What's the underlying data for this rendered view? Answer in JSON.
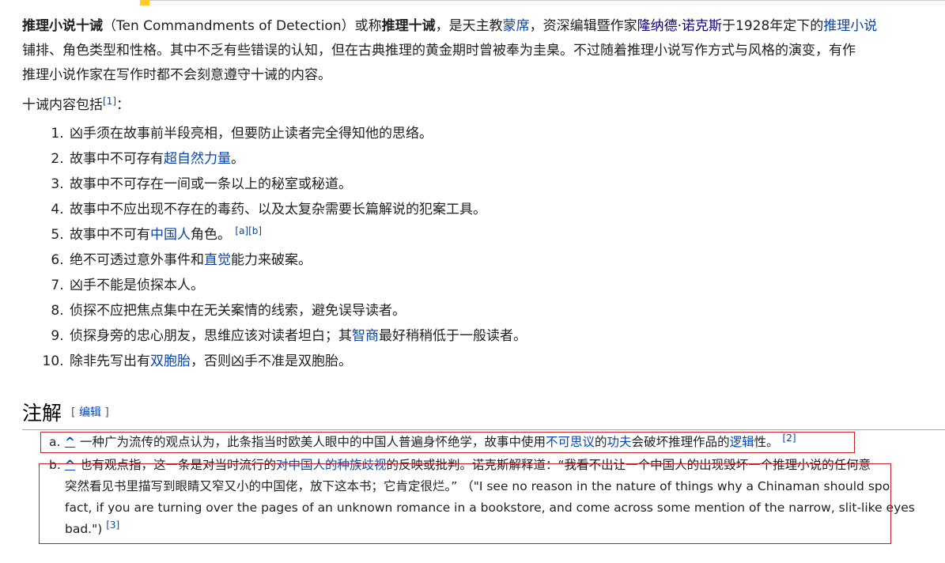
{
  "intro": {
    "line1": {
      "bold1": "推理小说十诫",
      "t1": "（Ten Commandments of Detection）或称",
      "bold2": "推理十诫",
      "t2": "，是天主教",
      "link_monsignor": "蒙席",
      "t3": "，资深编辑暨作家",
      "link_knox": "隆纳德·诺克斯",
      "t4": "于1928年定下的",
      "link_detective": "推理小说"
    },
    "line2": "铺排、角色类型和性格。其中不乏有些错误的认知，但在古典推理的黄金期时曾被奉为圭臬。不过随着推理小说写作方式与风格的演变，有作",
    "line3": "推理小说作家在写作时都不会刻意遵守十诫的内容。"
  },
  "list_intro": {
    "text": "十诫内容包括",
    "ref": "[1]",
    "colon": "："
  },
  "commandments": [
    {
      "pre": "凶手须在故事前半段亮相，但要防止读者完全得知他的思络。",
      "link": "",
      "post": "",
      "ref": ""
    },
    {
      "pre": "故事中不可存有",
      "link": "超自然力量",
      "post": "。",
      "ref": ""
    },
    {
      "pre": "故事中不可存在一间或一条以上的秘室或秘道。",
      "link": "",
      "post": "",
      "ref": ""
    },
    {
      "pre": "故事中不应出现不存在的毒药、以及太复杂需要长篇解说的犯案工具。",
      "link": "",
      "post": "",
      "ref": ""
    },
    {
      "pre": "故事中不可有",
      "link": "中国人",
      "post": "角色。",
      "ref": "[a][b]"
    },
    {
      "pre": "绝不可透过意外事件和",
      "link": "直觉",
      "post": "能力来破案。",
      "ref": ""
    },
    {
      "pre": "凶手不能是侦探本人。",
      "link": "",
      "post": "",
      "ref": ""
    },
    {
      "pre": "侦探不应把焦点集中在无关案情的线索，避免误导读者。",
      "link": "",
      "post": "",
      "ref": ""
    },
    {
      "pre": "侦探身旁的忠心朋友，思维应该对读者坦白；其",
      "link": "智商",
      "post": "最好稍稍低于一般读者。",
      "ref": ""
    },
    {
      "pre": "除非先写出有",
      "link": "双胞胎",
      "post": "，否则凶手不准是双胞胎。",
      "ref": ""
    }
  ],
  "notes_section": {
    "title": "注解",
    "edit_open": "[ ",
    "edit_label": "编辑",
    "edit_close": " ]"
  },
  "notes": {
    "a": {
      "marker": "a.",
      "caret": "^",
      "t1": "一种广为流传的观点认为，此条指当时欧美人眼中的中国人普遍身怀绝学，故事中使用",
      "link1": "不可思议",
      "t2": "的",
      "link2": "功夫",
      "t3": "会破坏推理作品的",
      "link3": "逻辑",
      "t4": "性。",
      "ref": "[2]"
    },
    "b": {
      "marker": "b.",
      "caret": "^",
      "t1": "也有观点指，这一条是对当时流行的",
      "link1": "对中国人的种族歧视",
      "t2": "的反映或批判。诺克斯解释道：“我看不出让一个中国人的出现毁坏一个推理小说的任何意",
      "line2": "突然看见书里描写到眼睛又窄又小的中国佬，放下这本书；它肯定很烂。” （\"I see no reason in the nature of things why a Chinaman should spo",
      "line3": "fact, if you are turning over the pages of an unknown romance in a bookstore, and come across some mention of the narrow, slit-like eyes",
      "line4": "bad.\")",
      "ref": "[3]"
    }
  },
  "colors": {
    "link": "#0645ad",
    "visited_link": "#0b0080",
    "highlight_box": "#c8202a",
    "text": "#202122"
  }
}
